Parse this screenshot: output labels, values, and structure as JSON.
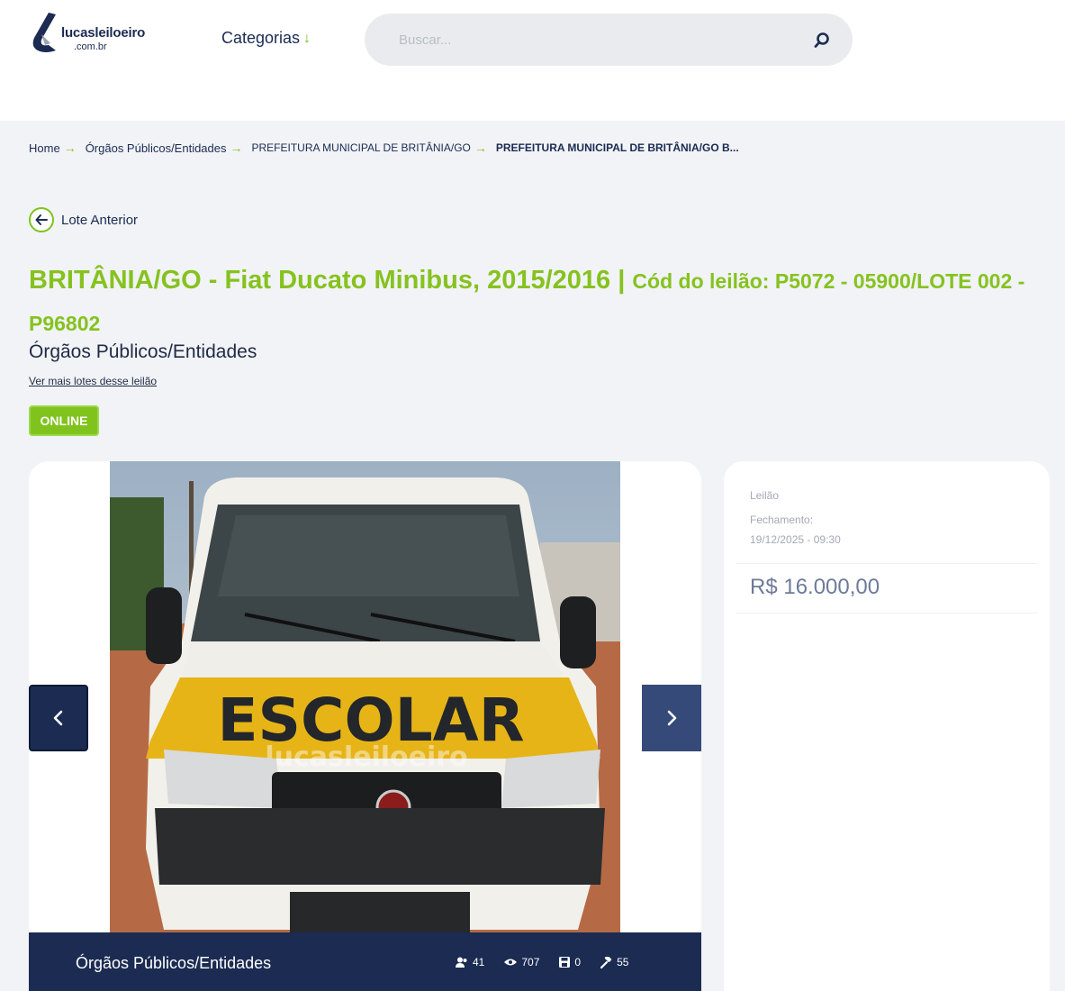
{
  "header": {
    "logo_name": "lucasleiloeiro",
    "logo_tld": ".com.br",
    "categories_label": "Categorias",
    "search_placeholder": "Buscar..."
  },
  "breadcrumb": {
    "items": [
      "Home",
      "Órgãos Públicos/Entidades",
      "PREFEITURA MUNICIPAL DE BRITÂNIA/GO",
      "PREFEITURA MUNICIPAL DE BRITÂNIA/GO B..."
    ]
  },
  "lot": {
    "prev_label": "Lote Anterior",
    "title_main": "BRITÂNIA/GO - Fiat Ducato Minibus, 2015/2016 | ",
    "title_code": "Cód do leilão: P5072 - 05900/LOTE 002 - P96802",
    "category": "Órgãos Públicos/Entidades",
    "more_lots_link": "Ver mais lotes desse leilão",
    "status_badge": "ONLINE"
  },
  "gallery": {
    "photo_text": "ESCOLAR",
    "watermark": "lucasleiloeiro",
    "footer_category": "Órgãos Públicos/Entidades",
    "stats": {
      "bidders": "41",
      "views": "707",
      "saved": "0",
      "bids": "55"
    }
  },
  "auction_panel": {
    "type_label": "Leilão",
    "closing_label": "Fechamento:",
    "closing_datetime": "19/12/2025 - 09:30",
    "price": "R$ 16.000,00"
  },
  "colors": {
    "accent_green": "#7fc31c",
    "navy": "#1b2b52",
    "background": "#f1f3f6"
  }
}
